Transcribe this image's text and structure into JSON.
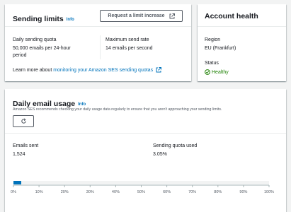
{
  "sending_limits": {
    "title": "Sending limits",
    "info": "Info",
    "request_button": "Request a limit increase",
    "quota_label": "Daily sending quota",
    "quota_value_line1": "50,000 emails per 24-hour",
    "quota_value_line2": "period",
    "rate_label": "Maximum send rate",
    "rate_value": "14 emails per second",
    "learn_more_prefix": "Learn more about ",
    "learn_more_link": "monitoring your Amazon SES sending quotas"
  },
  "account_health": {
    "title": "Account health",
    "region_label": "Region",
    "region_value": "EU (Frankfurt)",
    "status_label": "Status",
    "status_value": "Healthy",
    "status_color": "#1d8102"
  },
  "daily_usage": {
    "title": "Daily email usage",
    "info": "Info",
    "description": "Amazon SES recommends checking your daily usage data regularly to ensure that you aren't approaching your sending limits.",
    "emails_sent_label": "Emails sent",
    "emails_sent_value": "1,524",
    "quota_used_label": "Sending quota used",
    "quota_used_value": "3.05%"
  },
  "chart_data": {
    "type": "bar",
    "orientation": "horizontal",
    "value": 3.05,
    "xlim": [
      0,
      100
    ],
    "ticks": [
      "0%",
      "10%",
      "20%",
      "30%",
      "40%",
      "50%",
      "60%",
      "70%",
      "80%",
      "90%",
      "100%"
    ],
    "bar_color": "#0073bb"
  }
}
